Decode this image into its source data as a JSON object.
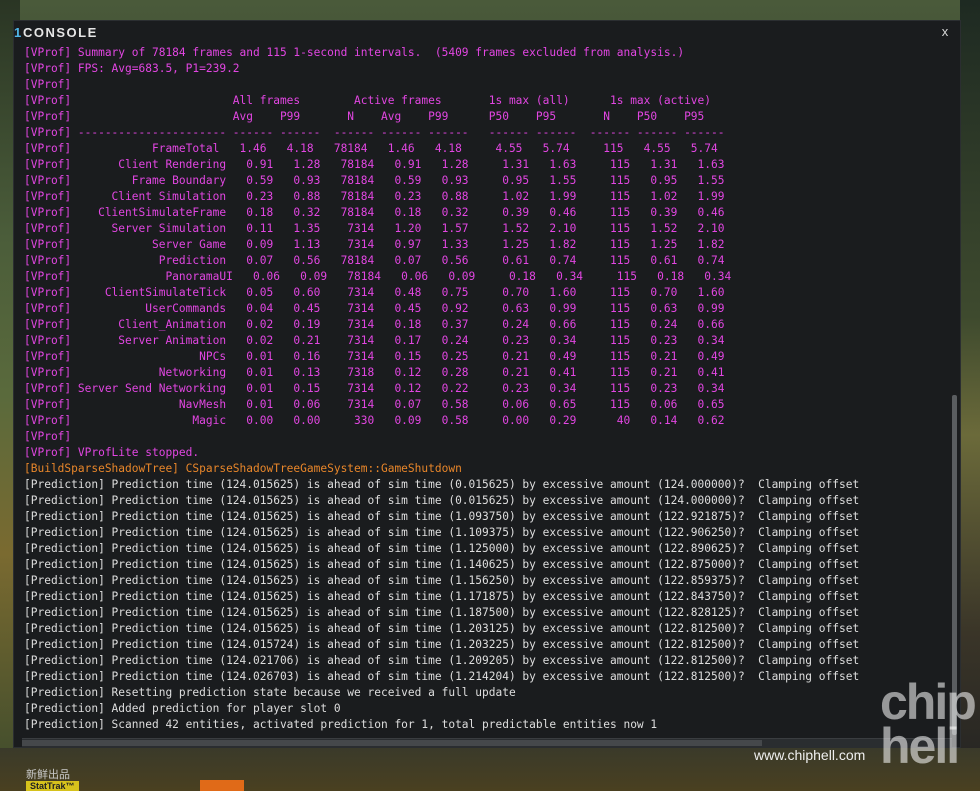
{
  "window": {
    "title_number": "1",
    "title": "CONSOLE",
    "close_label": "x"
  },
  "watermark": {
    "url": "www.chiphell.com",
    "logo_line1": "chip",
    "logo_line2": "hell"
  },
  "background": {
    "item_label": "StatTrak™",
    "caption": "新鲜出品"
  },
  "log_lines": [
    {
      "color": "magenta",
      "text": "[VProf] Summary of 78184 frames and 115 1-second intervals.  (5409 frames excluded from analysis.)"
    },
    {
      "color": "magenta",
      "text": "[VProf] FPS: Avg=683.5, P1=239.2"
    },
    {
      "color": "magenta",
      "text": "[VProf]"
    },
    {
      "color": "magenta",
      "text": "[VProf]                        All frames        Active frames       1s max (all)      1s max (active)"
    },
    {
      "color": "magenta",
      "text": "[VProf]                        Avg    P99       N    Avg    P99      P50    P95       N    P50    P95"
    },
    {
      "color": "magenta",
      "text": "[VProf] ---------------------- ------ ------  ------ ------ ------   ------ ------  ------ ------ ------"
    },
    {
      "color": "magenta",
      "text": "[VProf]            FrameTotal   1.46   4.18   78184   1.46   4.18     4.55   5.74     115   4.55   5.74"
    },
    {
      "color": "magenta",
      "text": "[VProf]       Client Rendering   0.91   1.28   78184   0.91   1.28     1.31   1.63     115   1.31   1.63"
    },
    {
      "color": "magenta",
      "text": "[VProf]         Frame Boundary   0.59   0.93   78184   0.59   0.93     0.95   1.55     115   0.95   1.55"
    },
    {
      "color": "magenta",
      "text": "[VProf]      Client Simulation   0.23   0.88   78184   0.23   0.88     1.02   1.99     115   1.02   1.99"
    },
    {
      "color": "magenta",
      "text": "[VProf]    ClientSimulateFrame   0.18   0.32   78184   0.18   0.32     0.39   0.46     115   0.39   0.46"
    },
    {
      "color": "magenta",
      "text": "[VProf]      Server Simulation   0.11   1.35    7314   1.20   1.57     1.52   2.10     115   1.52   2.10"
    },
    {
      "color": "magenta",
      "text": "[VProf]            Server Game   0.09   1.13    7314   0.97   1.33     1.25   1.82     115   1.25   1.82"
    },
    {
      "color": "magenta",
      "text": "[VProf]             Prediction   0.07   0.56   78184   0.07   0.56     0.61   0.74     115   0.61   0.74"
    },
    {
      "color": "magenta",
      "text": "[VProf]              PanoramaUI   0.06   0.09   78184   0.06   0.09     0.18   0.34     115   0.18   0.34"
    },
    {
      "color": "magenta",
      "text": "[VProf]     ClientSimulateTick   0.05   0.60    7314   0.48   0.75     0.70   1.60     115   0.70   1.60"
    },
    {
      "color": "magenta",
      "text": "[VProf]           UserCommands   0.04   0.45    7314   0.45   0.92     0.63   0.99     115   0.63   0.99"
    },
    {
      "color": "magenta",
      "text": "[VProf]       Client_Animation   0.02   0.19    7314   0.18   0.37     0.24   0.66     115   0.24   0.66"
    },
    {
      "color": "magenta",
      "text": "[VProf]       Server Animation   0.02   0.21    7314   0.17   0.24     0.23   0.34     115   0.23   0.34"
    },
    {
      "color": "magenta",
      "text": "[VProf]                   NPCs   0.01   0.16    7314   0.15   0.25     0.21   0.49     115   0.21   0.49"
    },
    {
      "color": "magenta",
      "text": "[VProf]             Networking   0.01   0.13    7318   0.12   0.28     0.21   0.41     115   0.21   0.41"
    },
    {
      "color": "magenta",
      "text": "[VProf] Server Send Networking   0.01   0.15    7314   0.12   0.22     0.23   0.34     115   0.23   0.34"
    },
    {
      "color": "magenta",
      "text": "[VProf]                NavMesh   0.01   0.06    7314   0.07   0.58     0.06   0.65     115   0.06   0.65"
    },
    {
      "color": "magenta",
      "text": "[VProf]                  Magic   0.00   0.00     330   0.09   0.58     0.00   0.29      40   0.14   0.62"
    },
    {
      "color": "magenta",
      "text": "[VProf]"
    },
    {
      "color": "magenta",
      "text": "[VProf] VProfLite stopped."
    },
    {
      "color": "orange",
      "text": "[BuildSparseShadowTree] CSparseShadowTreeGameSystem::GameShutdown"
    },
    {
      "color": "white",
      "text": "[Prediction] Prediction time (124.015625) is ahead of sim time (0.015625) by excessive amount (124.000000)?  Clamping offset"
    },
    {
      "color": "white",
      "text": "[Prediction] Prediction time (124.015625) is ahead of sim time (0.015625) by excessive amount (124.000000)?  Clamping offset"
    },
    {
      "color": "white",
      "text": "[Prediction] Prediction time (124.015625) is ahead of sim time (1.093750) by excessive amount (122.921875)?  Clamping offset"
    },
    {
      "color": "white",
      "text": "[Prediction] Prediction time (124.015625) is ahead of sim time (1.109375) by excessive amount (122.906250)?  Clamping offset"
    },
    {
      "color": "white",
      "text": "[Prediction] Prediction time (124.015625) is ahead of sim time (1.125000) by excessive amount (122.890625)?  Clamping offset"
    },
    {
      "color": "white",
      "text": "[Prediction] Prediction time (124.015625) is ahead of sim time (1.140625) by excessive amount (122.875000)?  Clamping offset"
    },
    {
      "color": "white",
      "text": "[Prediction] Prediction time (124.015625) is ahead of sim time (1.156250) by excessive amount (122.859375)?  Clamping offset"
    },
    {
      "color": "white",
      "text": "[Prediction] Prediction time (124.015625) is ahead of sim time (1.171875) by excessive amount (122.843750)?  Clamping offset"
    },
    {
      "color": "white",
      "text": "[Prediction] Prediction time (124.015625) is ahead of sim time (1.187500) by excessive amount (122.828125)?  Clamping offset"
    },
    {
      "color": "white",
      "text": "[Prediction] Prediction time (124.015625) is ahead of sim time (1.203125) by excessive amount (122.812500)?  Clamping offset"
    },
    {
      "color": "white",
      "text": "[Prediction] Prediction time (124.015724) is ahead of sim time (1.203225) by excessive amount (122.812500)?  Clamping offset"
    },
    {
      "color": "white",
      "text": "[Prediction] Prediction time (124.021706) is ahead of sim time (1.209205) by excessive amount (122.812500)?  Clamping offset"
    },
    {
      "color": "white",
      "text": "[Prediction] Prediction time (124.026703) is ahead of sim time (1.214204) by excessive amount (122.812500)?  Clamping offset"
    },
    {
      "color": "white",
      "text": "[Prediction] Resetting prediction state because we received a full update"
    },
    {
      "color": "white",
      "text": "[Prediction] Added prediction for player slot 0"
    },
    {
      "color": "white",
      "text": "[Prediction] Scanned 42 entities, activated prediction for 1, total predictable entities now 1"
    }
  ],
  "colors": {
    "magenta": "#e246e2",
    "orange": "#e8862a",
    "white": "#dedede",
    "title_accent": "#4fb6e8"
  }
}
